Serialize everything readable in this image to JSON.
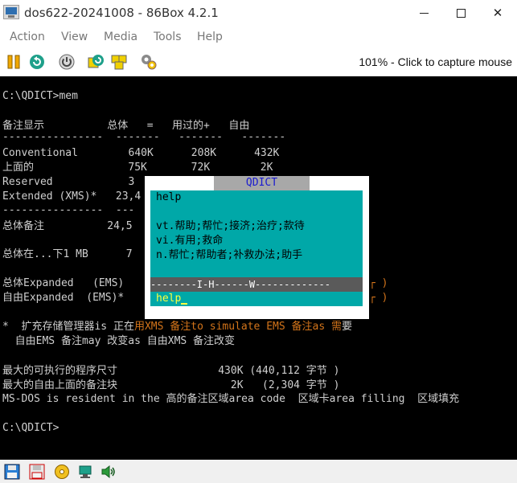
{
  "window": {
    "title": "dos622-20241008 - 86Box 4.2.1",
    "caption_buttons": {
      "minimize": "",
      "maximize": "",
      "close": "✕"
    }
  },
  "menu": [
    "Action",
    "View",
    "Media",
    "Tools",
    "Help"
  ],
  "toolbar": {
    "buttons": [
      "pause-icon",
      "reset-icon",
      "power-icon",
      "ctrl-alt-del-icon",
      "ctrl-alt-esc-icon",
      "settings-icon"
    ],
    "status": "101% - Click to capture mouse"
  },
  "dos": {
    "prompt1": "C:\\QDICT>mem",
    "header": "备注显示          总体   =   用过的+   自由",
    "dashes": "----------------  -------   -------   -------",
    "row_conventional": "Conventional        640K      208K      432K",
    "row_upper": "上面的               75K       72K        2K",
    "row_reserved": "Reserved            3",
    "row_extended": "Extended (XMS)*   23,4",
    "dashes2": "----------------  ---",
    "row_total": "总体备注          24,5",
    "row_under1mb": "总体在...下1 MB      7",
    "row_expanded": "总体Expanded   (EMS)",
    "row_free_expanded": "自由Expanded  (EMS)*",
    "note_star": "*  扩充存储管理器is 正在",
    "note_orange": "用XMS 备注to simulate EMS 备注as 需",
    "note_end": "要",
    "note2": "  自由EMS 备注may 改变as 自由XMS 备注改变",
    "largest_exec": "最大的可执行的程序尺寸                430K (440,112 字节 )",
    "largest_upper": "最大的自由上面的备注块                  2K   (2,304 字节 )",
    "resident": "MS-DOS is resident in the 高的备注区域area code  区域卡area filling  区域填充",
    "prompt2": "C:\\QDICT>",
    "edge_bracket1": "┌ )",
    "edge_bracket2": "┌ )"
  },
  "qdict": {
    "title": "QDICT",
    "word": "help",
    "def_vt": "vt.帮助;帮忙;接济;治疗;款待",
    "def_vi": "vi.有用;救命",
    "def_n": "n.帮忙;帮助者;补救办法;助手",
    "separator": "--------I-H------W-------------",
    "input": "help"
  },
  "statusbar": {
    "icons": [
      "floppy-drive-1-icon",
      "floppy-drive-2-icon",
      "cdrom-icon",
      "network-icon",
      "sound-icon"
    ]
  }
}
